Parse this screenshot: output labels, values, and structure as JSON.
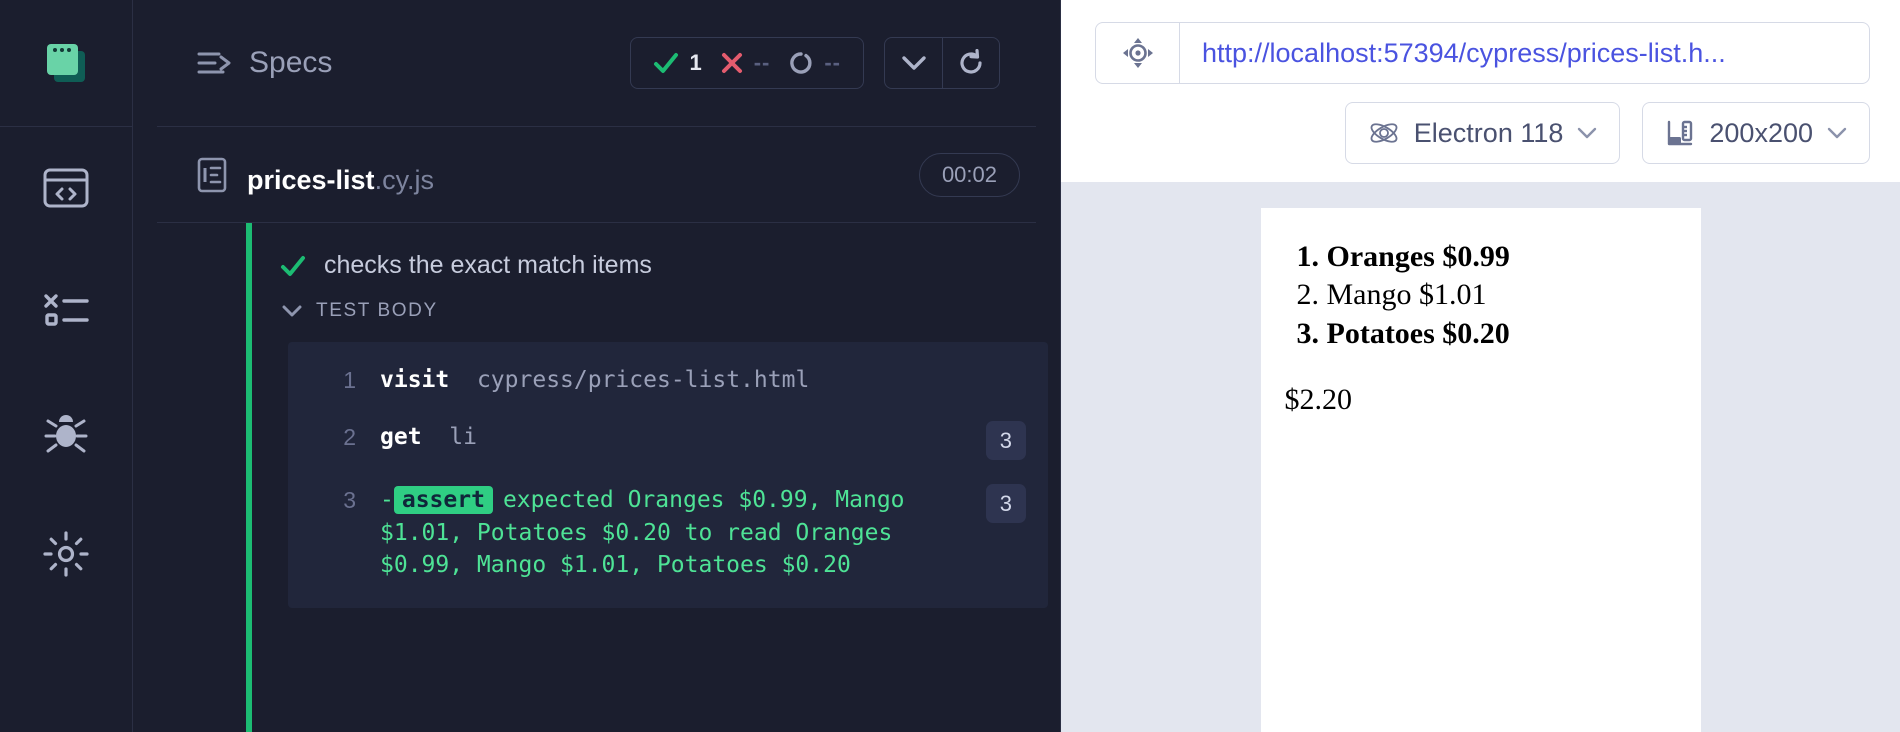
{
  "rail": {
    "logo_icon": "cypress-logo-icon",
    "items": [
      {
        "name": "specs-nav-icon",
        "icon": "browser-code-icon"
      },
      {
        "name": "runs-nav-icon",
        "icon": "test-results-icon"
      },
      {
        "name": "debug-nav-icon",
        "icon": "bug-icon"
      },
      {
        "name": "settings-nav-icon",
        "icon": "gear-icon"
      }
    ]
  },
  "reporter": {
    "header": {
      "title": "Specs",
      "title_icon": "specs-arrow-icon",
      "stats": [
        {
          "key": "passed",
          "icon": "check-icon",
          "value": "1",
          "color": "#1cbc73"
        },
        {
          "key": "failed",
          "icon": "x-icon",
          "value": "--",
          "color": "#e45c6e"
        },
        {
          "key": "pending",
          "icon": "circle-dash-icon",
          "value": "--",
          "color": "#9aa0b8"
        }
      ],
      "collapse_button_icon": "chevron-down-icon",
      "restart_button_icon": "refresh-icon"
    },
    "spec": {
      "file_icon": "file-document-icon",
      "base_name": "prices-list",
      "extension": ".cy.js",
      "duration": "00:02"
    },
    "test": {
      "status_icon": "check-icon",
      "title": "checks the exact match items",
      "body_toggle_icon": "chevron-down-icon",
      "body_label": "TEST BODY",
      "commands": [
        {
          "number": "1",
          "method": "visit",
          "argument": "cypress/prices-list.html",
          "badge": ""
        },
        {
          "number": "2",
          "method": "get",
          "argument": "li",
          "badge": "3"
        },
        {
          "number": "3",
          "prefix": "-",
          "tag": "assert",
          "assert_text": "expected Oranges $0.99, Mango $1.01, Potatoes $0.20 to read Oranges $0.99, Mango $1.01, Potatoes $0.20",
          "badge": "3"
        }
      ]
    }
  },
  "preview": {
    "url_selector_icon": "selector-playground-icon",
    "url": "http://localhost:57394/cypress/prices-list.h...",
    "browser_selector": {
      "icon": "electron-atom-icon",
      "label": "Electron 118",
      "chevron_icon": "chevron-down-icon"
    },
    "viewport_selector": {
      "icon": "ruler-icon",
      "label": "200x200",
      "chevron_icon": "chevron-down-icon"
    },
    "app": {
      "items": [
        {
          "text": "Oranges $0.99",
          "bold": true
        },
        {
          "text": "Mango $1.01",
          "bold": false
        },
        {
          "text": "Potatoes $0.20",
          "bold": true
        }
      ],
      "total": "$2.20"
    }
  },
  "colors": {
    "accent_green": "#1cbc73",
    "fail_red": "#e45c6e",
    "link_blue": "#4a53e0",
    "panel_bg": "#1b1e2e",
    "code_bg": "#21263b"
  }
}
